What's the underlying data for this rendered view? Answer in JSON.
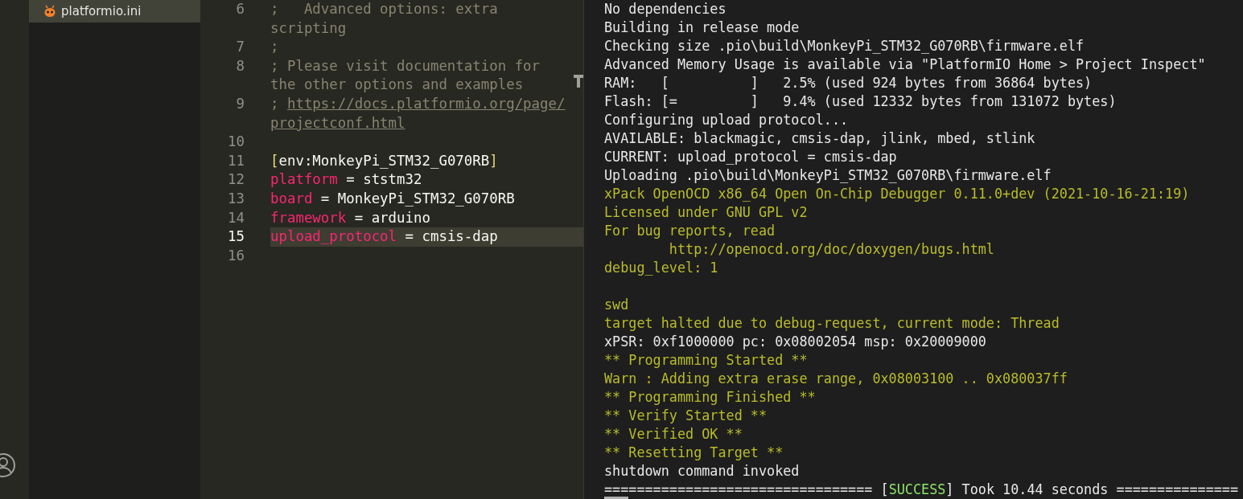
{
  "explorer": {
    "items": [
      {
        "label": "platformio.ini",
        "selected": true
      }
    ]
  },
  "editor": {
    "lines": [
      {
        "number": "6",
        "current": false,
        "tokens": [
          {
            "text": ";   Advanced options: extra scripting",
            "kind": "comment"
          }
        ]
      },
      {
        "number": "7",
        "current": false,
        "tokens": [
          {
            "text": ";",
            "kind": "comment"
          }
        ]
      },
      {
        "number": "8",
        "current": false,
        "tokens": [
          {
            "text": "; Please visit documentation for the other options and examples",
            "kind": "comment"
          }
        ]
      },
      {
        "number": "9",
        "current": false,
        "tokens": [
          {
            "text": "; ",
            "kind": "comment"
          },
          {
            "text": "https://docs.platformio.org/page/projectconf.html",
            "kind": "link"
          }
        ]
      },
      {
        "number": "10",
        "current": false
      },
      {
        "number": "11",
        "current": false,
        "tokens": [
          {
            "text": "[",
            "kind": "bracket"
          },
          {
            "text": "env:MonkeyPi_STM32_G070RB",
            "kind": "plain"
          },
          {
            "text": "]",
            "kind": "bracket"
          }
        ]
      },
      {
        "number": "12",
        "current": false,
        "tokens": [
          {
            "text": "platform",
            "kind": "key"
          },
          {
            "text": " = ststm32",
            "kind": "plain"
          }
        ]
      },
      {
        "number": "13",
        "current": false,
        "tokens": [
          {
            "text": "board",
            "kind": "key"
          },
          {
            "text": " = MonkeyPi_STM32_G070RB",
            "kind": "plain"
          }
        ]
      },
      {
        "number": "14",
        "current": false,
        "tokens": [
          {
            "text": "framework",
            "kind": "key"
          },
          {
            "text": " = arduino",
            "kind": "plain"
          }
        ]
      },
      {
        "number": "15",
        "current": true,
        "tokens": [
          {
            "text": "upload_protocol",
            "kind": "key"
          },
          {
            "text": " = cmsis-dap",
            "kind": "plain"
          }
        ]
      },
      {
        "number": "16",
        "current": false
      }
    ]
  },
  "terminal": {
    "lines": [
      {
        "segments": [
          {
            "text": "No dependencies",
            "kind": "output"
          }
        ]
      },
      {
        "segments": [
          {
            "text": "Building in release mode",
            "kind": "output"
          }
        ]
      },
      {
        "segments": [
          {
            "text": "Checking size .pio\\build\\MonkeyPi_STM32_G070RB\\firmware.elf",
            "kind": "output"
          }
        ]
      },
      {
        "segments": [
          {
            "text": "Advanced Memory Usage is available via \"PlatformIO Home > Project Inspect\"",
            "kind": "output"
          }
        ]
      },
      {
        "segments": [
          {
            "text": "RAM:   [          ]   2.5% (used 924 bytes from 36864 bytes)",
            "kind": "output"
          }
        ]
      },
      {
        "segments": [
          {
            "text": "Flash: [=         ]   9.4% (used 12332 bytes from 131072 bytes)",
            "kind": "output"
          }
        ]
      },
      {
        "segments": [
          {
            "text": "Configuring upload protocol...",
            "kind": "output"
          }
        ]
      },
      {
        "segments": [
          {
            "text": "AVAILABLE: blackmagic, cmsis-dap, jlink, mbed, stlink",
            "kind": "output"
          }
        ]
      },
      {
        "segments": [
          {
            "text": "CURRENT: upload_protocol = cmsis-dap",
            "kind": "output"
          }
        ]
      },
      {
        "segments": [
          {
            "text": "Uploading .pio\\build\\MonkeyPi_STM32_G070RB\\firmware.elf",
            "kind": "output"
          }
        ]
      },
      {
        "segments": [
          {
            "text": "xPack OpenOCD x86_64 Open On-Chip Debugger 0.11.0+dev (2021-10-16-21:19)",
            "kind": "ocd"
          }
        ]
      },
      {
        "segments": [
          {
            "text": "Licensed under GNU GPL v2",
            "kind": "ocd"
          }
        ]
      },
      {
        "segments": [
          {
            "text": "For bug reports, read",
            "kind": "ocd"
          }
        ]
      },
      {
        "segments": [
          {
            "text": "        http://openocd.org/doc/doxygen/bugs.html",
            "kind": "ocd"
          }
        ]
      },
      {
        "segments": [
          {
            "text": "debug_level: 1",
            "kind": "ocd"
          }
        ]
      },
      {
        "kind": "blank"
      },
      {
        "segments": [
          {
            "text": "swd",
            "kind": "ocd"
          }
        ]
      },
      {
        "segments": [
          {
            "text": "target halted due to debug-request, current mode: Thread",
            "kind": "ocd"
          }
        ]
      },
      {
        "segments": [
          {
            "text": "xPSR: 0xf1000000 pc: 0x08002054 msp: 0x20009000",
            "kind": "output"
          }
        ]
      },
      {
        "segments": [
          {
            "text": "** Programming Started **",
            "kind": "ocd"
          }
        ]
      },
      {
        "segments": [
          {
            "text": "Warn : Adding extra erase range, 0x08003100 .. 0x080037ff",
            "kind": "ocd"
          }
        ]
      },
      {
        "segments": [
          {
            "text": "** Programming Finished **",
            "kind": "ocd"
          }
        ]
      },
      {
        "segments": [
          {
            "text": "** Verify Started **",
            "kind": "ocd"
          }
        ]
      },
      {
        "segments": [
          {
            "text": "** Verified OK **",
            "kind": "ocd"
          }
        ]
      },
      {
        "segments": [
          {
            "text": "** Resetting Target **",
            "kind": "ocd"
          }
        ]
      },
      {
        "segments": [
          {
            "text": "shutdown command invoked",
            "kind": "output"
          }
        ]
      },
      {
        "segments": [
          {
            "text": "================================= [",
            "kind": "output"
          },
          {
            "text": "SUCCESS",
            "kind": "success"
          },
          {
            "text": "] Took 10.44 seconds ===============",
            "kind": "output"
          }
        ]
      }
    ]
  }
}
